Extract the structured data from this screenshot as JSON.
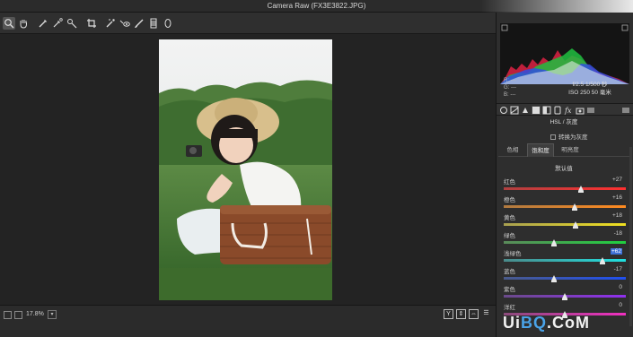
{
  "window": {
    "title": "Camera Raw (FX3E3822.JPG)"
  },
  "toolbar": {
    "tools": [
      {
        "name": "zoom-tool-icon",
        "active": true
      },
      {
        "name": "hand-tool-icon"
      },
      {
        "name": "white-balance-tool-icon"
      },
      {
        "name": "color-sampler-tool-icon"
      },
      {
        "name": "targeted-adjustment-tool-icon"
      },
      {
        "name": "crop-tool-icon"
      },
      {
        "name": "spot-removal-tool-icon"
      },
      {
        "name": "red-eye-tool-icon"
      },
      {
        "name": "adjustment-brush-icon"
      },
      {
        "name": "graduated-filter-icon"
      },
      {
        "name": "radial-filter-icon"
      }
    ]
  },
  "histogram": {
    "rgb": {
      "r": "R:",
      "g": "G:",
      "b": "B:",
      "r_val": "---",
      "g_val": "---",
      "b_val": "---"
    },
    "camera": {
      "line1": "f/2.5    1/500 秒",
      "line2": "ISO 250    50 毫米"
    }
  },
  "panel": {
    "title": "HSL / 灰度",
    "grayscale_label": "转换为灰度",
    "tabs": [
      "色相",
      "饱和度",
      "明亮度"
    ],
    "active_tab": 1,
    "defaults_label": "默认值",
    "sliders": [
      {
        "label": "红色",
        "value": "+27",
        "pct": 0.635,
        "colors": [
          "#b04040",
          "#ff3030"
        ]
      },
      {
        "label": "橙色",
        "value": "+16",
        "pct": 0.58,
        "colors": [
          "#b07a40",
          "#ff8a20"
        ]
      },
      {
        "label": "黄色",
        "value": "+18",
        "pct": 0.59,
        "colors": [
          "#a8a050",
          "#f0e020"
        ]
      },
      {
        "label": "绿色",
        "value": "-18",
        "pct": 0.41,
        "colors": [
          "#5a8a5a",
          "#20d040"
        ]
      },
      {
        "label": "浅绿色",
        "value": "+62",
        "pct": 0.81,
        "colors": [
          "#4a8a8a",
          "#20e0e0"
        ],
        "highlight": true
      },
      {
        "label": "蓝色",
        "value": "-17",
        "pct": 0.415,
        "colors": [
          "#4a5a8a",
          "#2050f0"
        ]
      },
      {
        "label": "紫色",
        "value": "0",
        "pct": 0.5,
        "colors": [
          "#6a4a8a",
          "#9030f0"
        ]
      },
      {
        "label": "洋红",
        "value": "0",
        "pct": 0.5,
        "colors": [
          "#8a4a7a",
          "#f030c0"
        ]
      }
    ]
  },
  "status": {
    "zoom": "17.8%"
  },
  "watermark": {
    "pre": "Ui",
    "hl": "BQ",
    "post": ".CoM"
  },
  "accent_color": "#3d6fd6"
}
